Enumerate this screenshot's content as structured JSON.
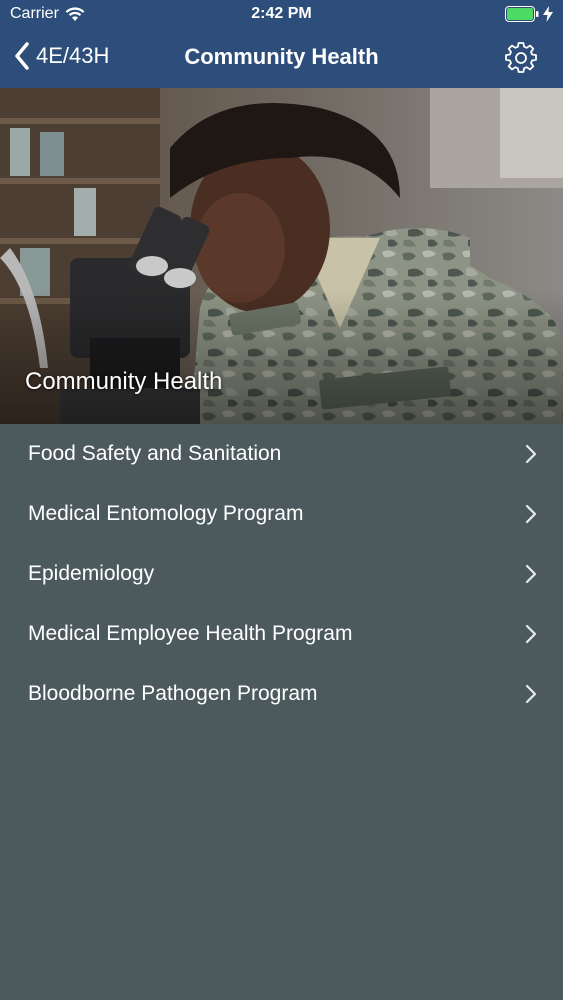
{
  "status_bar": {
    "carrier": "Carrier",
    "time": "2:42 PM",
    "icons": [
      "wifi-icon",
      "battery-icon",
      "charging-bolt-icon"
    ]
  },
  "nav": {
    "back_label": "4E/43H",
    "title": "Community Health",
    "settings_icon": "gear-icon"
  },
  "hero": {
    "caption": "Community Health"
  },
  "menu": {
    "items": [
      {
        "label": "Food Safety and Sanitation"
      },
      {
        "label": "Medical Entomology Program"
      },
      {
        "label": "Epidemiology"
      },
      {
        "label": "Medical Employee Health Program"
      },
      {
        "label": "Bloodborne Pathogen Program"
      }
    ]
  },
  "colors": {
    "nav_background": "#2d4e7a",
    "list_background": "#4c5a5d",
    "battery_fill": "#4cd964"
  }
}
